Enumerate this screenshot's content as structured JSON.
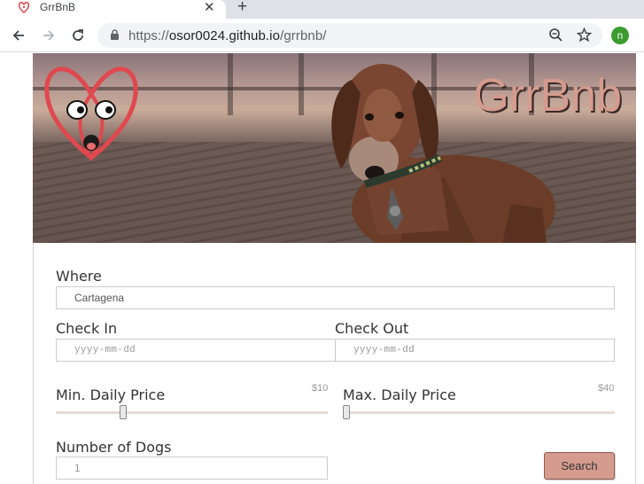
{
  "browser": {
    "tab_title": "GrrBnB",
    "tab_close": "✕",
    "new_tab": "+",
    "url_scheme": "https://",
    "url_host": "osor0024.github.io",
    "url_path": "/grrbnb/",
    "profile_initial": "n"
  },
  "hero": {
    "brand": "GrrBnb"
  },
  "form": {
    "where_label": "Where",
    "where_value": "Cartagena",
    "checkin_label": "Check In",
    "checkin_placeholder": "yyyy-mm-dd",
    "checkout_label": "Check Out",
    "checkout_placeholder": "yyyy-mm-dd",
    "min_price_label": "Min. Daily Price",
    "min_price_value": "$10",
    "min_price_position": 0.24,
    "max_price_label": "Max. Daily Price",
    "max_price_value": "$40",
    "max_price_position": 0.0,
    "dogs_label": "Number of Dogs",
    "dogs_value": "1",
    "search_label": "Search"
  },
  "colors": {
    "accent": "#d49b8e",
    "logo_red": "#e0484f",
    "profile_green": "#3c9b2f"
  },
  "icons": [
    "back-icon",
    "forward-icon",
    "reload-icon",
    "lock-icon",
    "zoom-icon",
    "star-icon"
  ]
}
